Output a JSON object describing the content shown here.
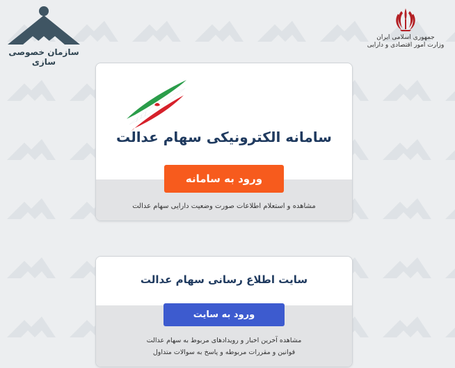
{
  "header": {
    "org_name": "سازمان خصوصی سازی",
    "gov_line1": "جمهوری اسلامی ایران",
    "gov_line2": "وزارت امور اقتصادی و دارایی"
  },
  "card1": {
    "title": "سامانه الکترونیکی سهام عدالت",
    "button_label": "ورود به سامانه",
    "description": "مشاهده و استعلام اطلاعات صورت وضعیت دارایی سهام عدالت"
  },
  "card2": {
    "title": "سایت اطلاع رسانی سهام عدالت",
    "button_label": "ورود به سایت",
    "description_line1": "مشاهده آخرین اخبار و رویدادهای مربوط به سهام عدالت",
    "description_line2": "قوانین و مقررات مربوطه و پاسخ به سوالات متداول"
  },
  "colors": {
    "background": "#eceef0",
    "title_navy": "#1f3a5f",
    "orange_button": "#f75b1d",
    "blue_button": "#3d5bcf",
    "flag_green": "#2a9d4a",
    "flag_red": "#d6202a",
    "logo_slate": "#3f5563"
  },
  "icons": {
    "org_logo": "privatization-org-logo-icon",
    "emblem": "iran-emblem-icon",
    "flag": "iran-flag-swoosh-icon"
  }
}
